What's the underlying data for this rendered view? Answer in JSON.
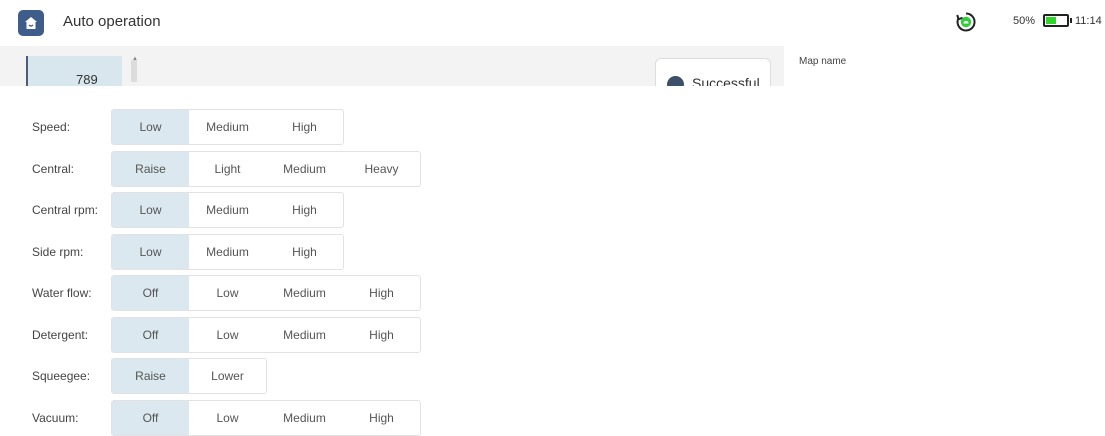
{
  "header": {
    "title": "Auto operation",
    "battery_percent_text": "50%",
    "battery_level": 0.5,
    "time": "11:14",
    "icons": [
      "home-icon",
      "sync-cloud-icon",
      "battery-icon"
    ]
  },
  "list": {
    "selected_item": "789"
  },
  "toast": {
    "text": "Successful"
  },
  "right_panel": {
    "map_name_label": "Map name"
  },
  "settings": {
    "rows": [
      {
        "label": "Speed:",
        "options": [
          "Low",
          "Medium",
          "High"
        ],
        "selected": "Low"
      },
      {
        "label": "Central:",
        "options": [
          "Raise",
          "Light",
          "Medium",
          "Heavy"
        ],
        "selected": "Raise"
      },
      {
        "label": "Central rpm:",
        "options": [
          "Low",
          "Medium",
          "High"
        ],
        "selected": "Low"
      },
      {
        "label": "Side rpm:",
        "options": [
          "Low",
          "Medium",
          "High"
        ],
        "selected": "Low"
      },
      {
        "label": "Water flow:",
        "options": [
          "Off",
          "Low",
          "Medium",
          "High"
        ],
        "selected": "Off"
      },
      {
        "label": "Detergent:",
        "options": [
          "Off",
          "Low",
          "Medium",
          "High"
        ],
        "selected": "Off"
      },
      {
        "label": "Squeegee:",
        "options": [
          "Raise",
          "Lower"
        ],
        "selected": "Raise"
      },
      {
        "label": "Vacuum:",
        "options": [
          "Off",
          "Low",
          "Medium",
          "High"
        ],
        "selected": "Off"
      }
    ]
  },
  "colors": {
    "accent": "#3f5d8a",
    "selected_segment": "#dbe8ef",
    "battery_green": "#2fd62a",
    "sync_green": "#2fcf3a"
  }
}
